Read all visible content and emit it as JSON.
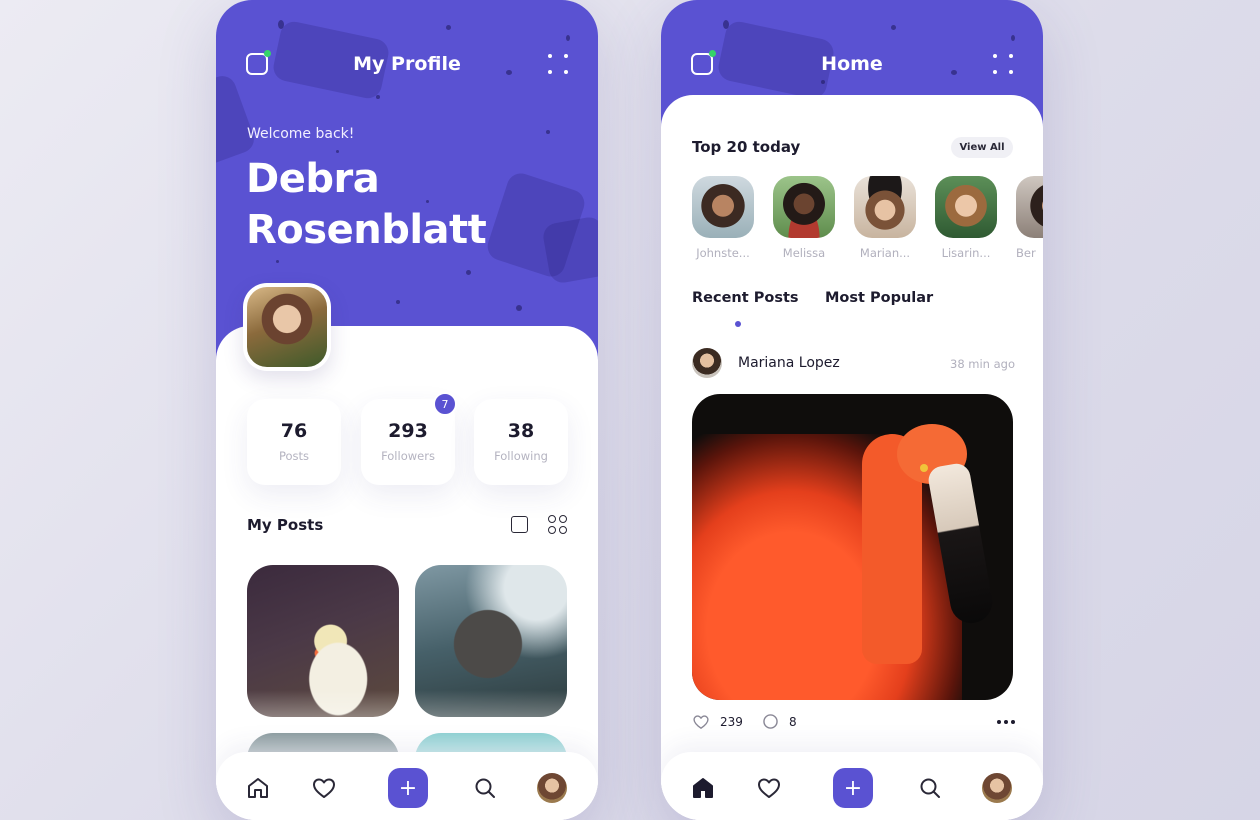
{
  "profile_screen": {
    "title": "My Profile",
    "welcome": "Welcome back!",
    "user_name": "Debra Rosenblatt",
    "stats": [
      {
        "value": "76",
        "label": "Posts"
      },
      {
        "value": "293",
        "label": "Followers",
        "badge": "7"
      },
      {
        "value": "38",
        "label": "Following"
      }
    ],
    "section_title": "My Posts",
    "posts": [
      {
        "icon": "cockatiel-photo"
      },
      {
        "icon": "elephant-photo"
      },
      {
        "icon": "dark-photo"
      },
      {
        "icon": "teal-photo"
      }
    ],
    "nav": [
      "home-icon",
      "heart-icon",
      "add-icon",
      "search-icon",
      "avatar"
    ],
    "add_label": "+"
  },
  "home_screen": {
    "title": "Home",
    "top_section_title": "Top 20 today",
    "view_all_label": "View All",
    "stories": [
      {
        "name": "Johnste..."
      },
      {
        "name": "Melissa"
      },
      {
        "name": "Marian..."
      },
      {
        "name": "Lisarin..."
      },
      {
        "name": "Ber"
      }
    ],
    "tabs": [
      "Recent Posts",
      "Most Popular"
    ],
    "active_tab": "Recent Posts",
    "post": {
      "author": "Mariana Lopez",
      "time": "38 min ago",
      "image": "flamingo-photo",
      "likes": "239",
      "comments": "8"
    },
    "add_label": "+"
  },
  "colors": {
    "accent": "#5a52d2",
    "online_dot": "#35d46a",
    "text_dark": "#1d1b2e",
    "text_muted": "#b1b0bd"
  }
}
